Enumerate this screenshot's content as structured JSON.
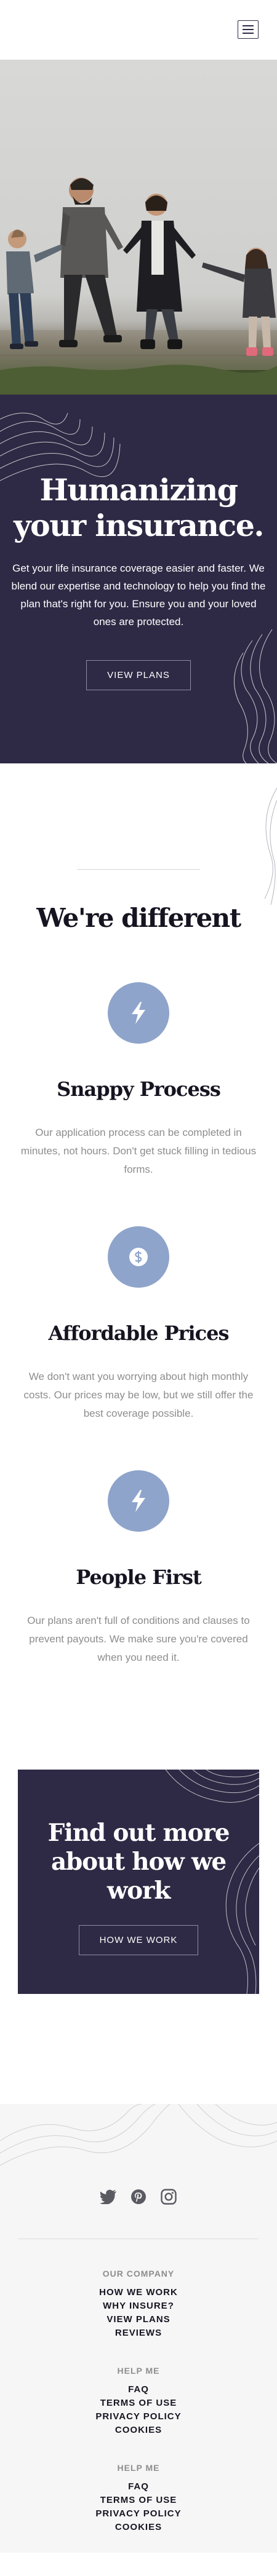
{
  "header": {
    "logo": "company-logo",
    "menu_icon": "hamburger-icon"
  },
  "hero_photo": {
    "alt": "A family of four holding hands walking on a sidewalk"
  },
  "intro": {
    "title": "Humanizing your insurance.",
    "text": "Get your life insurance coverage easier and faster. We blend our expertise and technology to help you find the plan that's right for you. Ensure you and your loved ones are protected.",
    "button": "View plans"
  },
  "features": {
    "heading": "We're different",
    "items": [
      {
        "icon": "lightning-icon",
        "title": "Snappy Process",
        "text": "Our application process can be completed in minutes, not hours. Don't get stuck filling in tedious forms."
      },
      {
        "icon": "dollar-coin-icon",
        "title": "Affordable Prices",
        "text": "We don't want you worrying about high monthly costs. Our prices may be low, but we still offer the best coverage possible."
      },
      {
        "icon": "lightning-icon",
        "title": "People First",
        "text": "Our plans aren't full of conditions and clauses to prevent payouts. We make sure you're covered when you need it."
      }
    ]
  },
  "cta": {
    "title": "Find out more about how we work",
    "button": "How we work"
  },
  "footer": {
    "social": [
      "twitter-icon",
      "pinterest-icon",
      "instagram-icon"
    ],
    "groups": [
      {
        "heading": "Our company",
        "links": [
          "How we work",
          "Why Insure?",
          "View plans",
          "Reviews"
        ]
      },
      {
        "heading": "Help me",
        "links": [
          "FAQ",
          "Terms of use",
          "Privacy policy",
          "Cookies"
        ]
      },
      {
        "heading": "Help me",
        "links": [
          "FAQ",
          "Terms of use",
          "Privacy policy",
          "Cookies"
        ]
      }
    ]
  },
  "colors": {
    "dark_violet": "#2e2944",
    "icon_blue": "#8fa4cb",
    "body_grey": "#8d8d8d",
    "footer_bg": "#f6f6f6"
  }
}
